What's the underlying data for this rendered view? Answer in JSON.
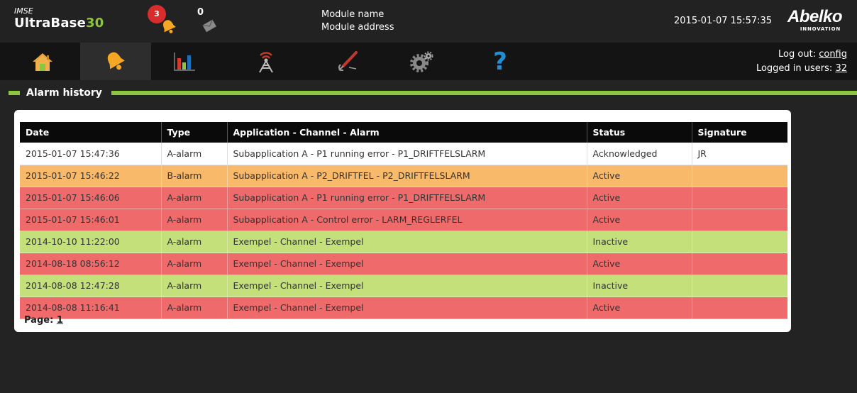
{
  "brand": {
    "prefix": "IMSE",
    "name": "UltraBase",
    "number": "30"
  },
  "alarms_count": "3",
  "messages_count": "0",
  "module": {
    "name": "Module name",
    "address": "Module address"
  },
  "datetime": "2015-01-07 15:57:35",
  "logo": {
    "name": "Abelko",
    "sub": "INNOVATION"
  },
  "nav": {
    "items": [
      {
        "icon": "home-icon"
      },
      {
        "icon": "bell-icon",
        "active": true
      },
      {
        "icon": "bar-chart-icon"
      },
      {
        "icon": "antenna-icon"
      },
      {
        "icon": "tools-icon"
      },
      {
        "icon": "gears-icon"
      },
      {
        "icon": "help-icon"
      }
    ],
    "logout_label": "Log out:",
    "logout_user": "config",
    "logged_in_label": "Logged in users:",
    "logged_in_count": "32"
  },
  "section": {
    "title": "Alarm history"
  },
  "table": {
    "headers": [
      "Date",
      "Type",
      "Application - Channel - Alarm",
      "Status",
      "Signature"
    ],
    "rows": [
      {
        "date": "2015-01-07 15:47:36",
        "type": "A-alarm",
        "desc": "Subapplication A - P1 running error - P1_DRIFTFELSLARM",
        "status": "Acknowledged",
        "signature": "JR"
      },
      {
        "date": "2015-01-07 15:46:22",
        "type": "B-alarm",
        "desc": "Subapplication A - P2_DRIFTFEL - P2_DRIFTFELSLARM",
        "status": "Active",
        "signature": ""
      },
      {
        "date": "2015-01-07 15:46:06",
        "type": "A-alarm",
        "desc": "Subapplication A - P1 running error - P1_DRIFTFELSLARM",
        "status": "Active",
        "signature": ""
      },
      {
        "date": "2015-01-07 15:46:01",
        "type": "A-alarm",
        "desc": "Subapplication A - Control error - LARM_REGLERFEL",
        "status": "Active",
        "signature": ""
      },
      {
        "date": "2014-10-10 11:22:00",
        "type": "A-alarm",
        "desc": "Exempel - Channel - Exempel",
        "status": "Inactive",
        "signature": ""
      },
      {
        "date": "2014-08-18 08:56:12",
        "type": "A-alarm",
        "desc": "Exempel - Channel - Exempel",
        "status": "Active",
        "signature": ""
      },
      {
        "date": "2014-08-08 12:47:28",
        "type": "A-alarm",
        "desc": "Exempel - Channel - Exempel",
        "status": "Inactive",
        "signature": ""
      },
      {
        "date": "2014-08-08 11:16:41",
        "type": "A-alarm",
        "desc": "Exempel - Channel - Exempel",
        "status": "Active",
        "signature": ""
      }
    ]
  },
  "pager": {
    "label": "Page:",
    "page": "1"
  },
  "colors": {
    "accent": "#8cc63f",
    "active": "#ef6b6b",
    "inactive": "#c3e07a",
    "b_alarm": "#f9b96a",
    "badge": "#d92d2d",
    "nav_icon_orange": "#f5a623",
    "help_blue": "#1f8fd6"
  }
}
